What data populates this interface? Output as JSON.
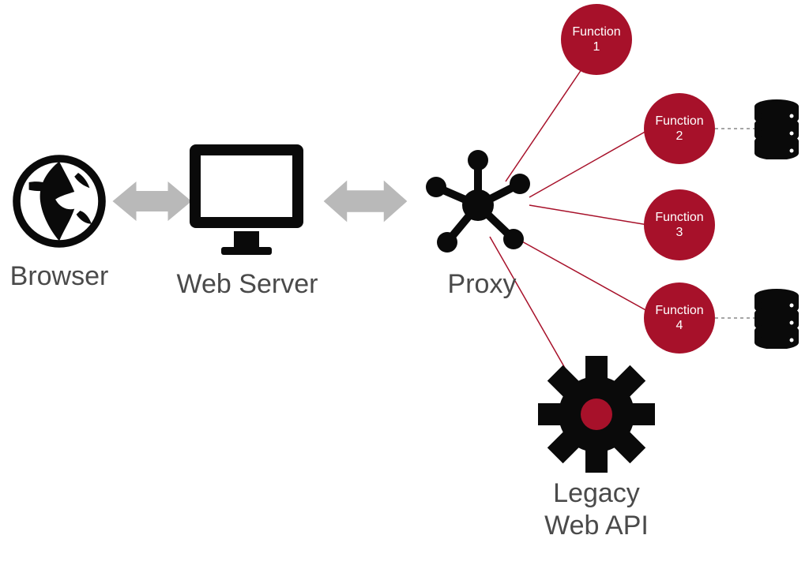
{
  "colors": {
    "accent": "#a7112a",
    "icon": "#0a0a0a",
    "arrow": "#b9b9b9",
    "label": "#4a4a4a"
  },
  "labels": {
    "browser": "Browser",
    "webserver": "Web Server",
    "proxy": "Proxy",
    "legacy": "Legacy\nWeb API"
  },
  "functions": [
    {
      "label": "Function\n1",
      "has_db": false
    },
    {
      "label": "Function\n2",
      "has_db": true
    },
    {
      "label": "Function\n3",
      "has_db": false
    },
    {
      "label": "Function\n4",
      "has_db": true
    }
  ]
}
